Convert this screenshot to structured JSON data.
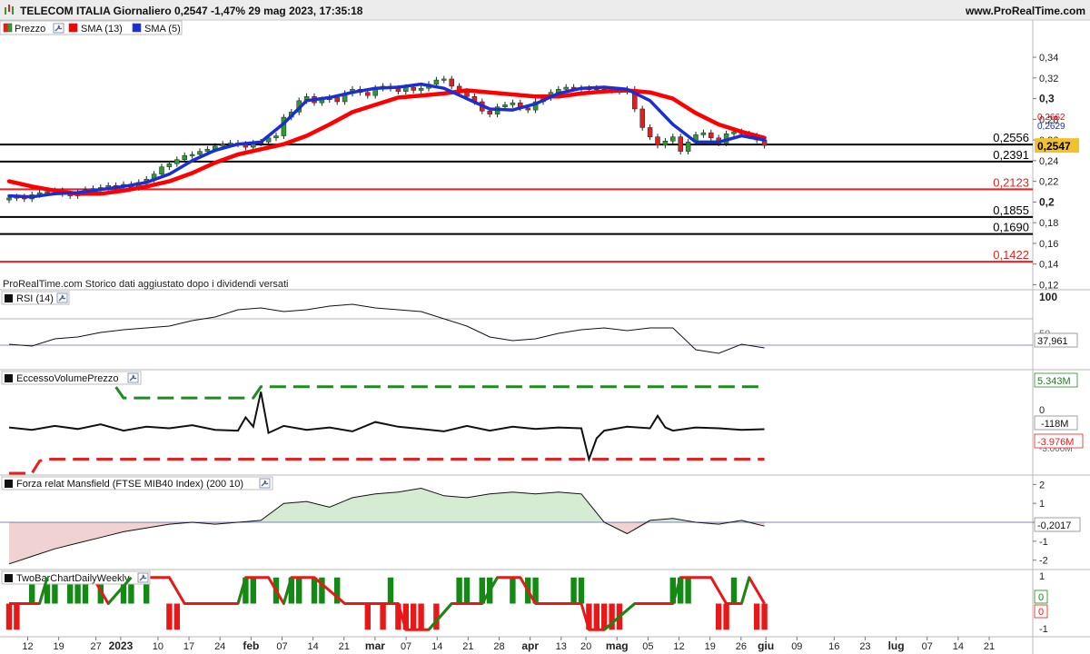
{
  "header": {
    "title": "TELECOM ITALIA Giornaliero 0,2547 -1,47% 29 mag 2023, 17:35:18",
    "site": "www.ProRealTime.com"
  },
  "colors": {
    "up_candle": "#2e9b2e",
    "down_candle": "#e02020",
    "sma13": "#ff0000",
    "sma5": "#1a2ed6",
    "last_price_box": "#f2c12e",
    "support_red": "#e82020",
    "volume_green": "#1f8a1f",
    "volume_red": "#e82020",
    "mansfield_pos_fill": "#d6ecd2",
    "mansfield_neg_fill": "#f0d2d2",
    "twobar_green": "#138a13",
    "twobar_red": "#e81818"
  },
  "price_panel": {
    "legend": [
      "Prezzo",
      "SMA (13)",
      "SMA (5)"
    ],
    "footnote": "ProRealTime.com Storico dati aggiustato dopo i dividendi versati",
    "axis_ticks": [
      "0,34",
      "0,32",
      "0,3",
      "0,28",
      "0,26",
      "0,24",
      "0,22",
      "0,2",
      "0,18",
      "0,16",
      "0,14",
      "0,12"
    ],
    "axis_tick_values": [
      0.34,
      0.32,
      0.3,
      0.28,
      0.26,
      0.24,
      0.22,
      0.2,
      0.18,
      0.16,
      0.14,
      0.12
    ],
    "ylim": [
      0.116,
      0.362
    ],
    "levels": [
      {
        "value": 0.2556,
        "label": "0,2556",
        "color": "black"
      },
      {
        "value": 0.2391,
        "label": "0,2391",
        "color": "black"
      },
      {
        "value": 0.2123,
        "label": "0,2123",
        "color": "red"
      },
      {
        "value": 0.1855,
        "label": "0,1855",
        "color": "black"
      },
      {
        "value": 0.169,
        "label": "0,1690",
        "color": "black"
      },
      {
        "value": 0.1422,
        "label": "0,1422",
        "color": "red"
      }
    ],
    "last_price_label": "0,2547",
    "last_price_value": 0.2547,
    "sma13_label": "0,2662",
    "sma13_value": 0.2662,
    "sma5_label": "0,2629",
    "sma5_value": 0.2629
  },
  "chart_data": [
    {
      "type": "candlestick",
      "name": "Prezzo",
      "x_range": [
        0,
        99
      ],
      "x": [
        0,
        1,
        2,
        3,
        4,
        5,
        6,
        7,
        8,
        9,
        10,
        11,
        12,
        13,
        14,
        15,
        16,
        17,
        18,
        19,
        20,
        21,
        22,
        23,
        24,
        25,
        26,
        27,
        28,
        29,
        30,
        31,
        32,
        33,
        34,
        35,
        36,
        37,
        38,
        39,
        40,
        41,
        42,
        43,
        44,
        45,
        46,
        47,
        48,
        49,
        50,
        51,
        52,
        53,
        54,
        55,
        56,
        57,
        58,
        59,
        60,
        61,
        62,
        63,
        64,
        65,
        66,
        67,
        68,
        69,
        70,
        71,
        72,
        73,
        74,
        75,
        76,
        77,
        78,
        79,
        80,
        81,
        82,
        83,
        84,
        85,
        86,
        87,
        88,
        89,
        90,
        91,
        92,
        93,
        94,
        95,
        96,
        97,
        98,
        99
      ],
      "close": [
        0.204,
        0.205,
        0.203,
        0.207,
        0.209,
        0.21,
        0.211,
        0.208,
        0.206,
        0.209,
        0.212,
        0.213,
        0.214,
        0.216,
        0.215,
        0.217,
        0.214,
        0.219,
        0.222,
        0.227,
        0.234,
        0.237,
        0.241,
        0.245,
        0.246,
        0.249,
        0.251,
        0.254,
        0.256,
        0.257,
        0.256,
        0.253,
        0.257,
        0.258,
        0.262,
        0.264,
        0.282,
        0.287,
        0.298,
        0.302,
        0.296,
        0.299,
        0.301,
        0.297,
        0.305,
        0.309,
        0.306,
        0.303,
        0.31,
        0.312,
        0.31,
        0.307,
        0.311,
        0.308,
        0.31,
        0.314,
        0.318,
        0.319,
        0.312,
        0.307,
        0.302,
        0.297,
        0.288,
        0.285,
        0.292,
        0.294,
        0.296,
        0.291,
        0.289,
        0.297,
        0.301,
        0.306,
        0.309,
        0.311,
        0.31,
        0.31,
        0.31,
        0.309,
        0.308,
        0.308,
        0.307,
        0.309,
        0.29,
        0.272,
        0.263,
        0.255,
        0.259,
        0.263,
        0.249,
        0.258,
        0.265,
        0.267,
        0.262,
        0.257,
        0.266,
        0.268,
        0.266,
        0.264,
        0.26,
        0.2547
      ],
      "ylim": [
        0.116,
        0.362
      ]
    },
    {
      "type": "line",
      "name": "SMA (13)",
      "x": [
        0,
        3,
        6,
        9,
        12,
        15,
        18,
        21,
        24,
        27,
        30,
        33,
        36,
        39,
        42,
        45,
        48,
        51,
        54,
        57,
        60,
        63,
        66,
        69,
        72,
        75,
        78,
        81,
        84,
        87,
        90,
        93,
        96,
        99
      ],
      "y": [
        0.22,
        0.215,
        0.211,
        0.208,
        0.208,
        0.211,
        0.215,
        0.22,
        0.228,
        0.238,
        0.246,
        0.251,
        0.256,
        0.264,
        0.275,
        0.287,
        0.294,
        0.301,
        0.303,
        0.305,
        0.308,
        0.306,
        0.304,
        0.302,
        0.302,
        0.305,
        0.307,
        0.308,
        0.306,
        0.3,
        0.286,
        0.275,
        0.268,
        0.262
      ],
      "ylim": [
        0.116,
        0.362
      ]
    },
    {
      "type": "line",
      "name": "SMA (5)",
      "x": [
        0,
        3,
        6,
        9,
        12,
        15,
        18,
        21,
        24,
        27,
        30,
        33,
        36,
        39,
        42,
        45,
        48,
        51,
        54,
        57,
        60,
        63,
        66,
        69,
        72,
        75,
        78,
        81,
        84,
        87,
        90,
        93,
        96,
        99
      ],
      "y": [
        0.206,
        0.205,
        0.208,
        0.209,
        0.212,
        0.215,
        0.219,
        0.227,
        0.24,
        0.25,
        0.256,
        0.258,
        0.276,
        0.298,
        0.301,
        0.306,
        0.31,
        0.311,
        0.314,
        0.31,
        0.3,
        0.29,
        0.289,
        0.295,
        0.305,
        0.31,
        0.311,
        0.309,
        0.298,
        0.275,
        0.258,
        0.258,
        0.264,
        0.26
      ],
      "ylim": [
        0.116,
        0.362
      ]
    },
    {
      "type": "line",
      "name": "RSI (14)",
      "axis_ticks": [
        "100",
        "50"
      ],
      "ylim": [
        15,
        100
      ],
      "last_label": "37,961",
      "last_value": 37.961,
      "x": [
        0,
        3,
        6,
        9,
        12,
        15,
        18,
        21,
        24,
        27,
        30,
        33,
        36,
        39,
        42,
        45,
        48,
        51,
        54,
        57,
        60,
        63,
        66,
        69,
        72,
        75,
        78,
        81,
        84,
        87,
        90,
        93,
        96,
        99
      ],
      "y": [
        42,
        40,
        48,
        50,
        55,
        58,
        60,
        62,
        68,
        72,
        80,
        82,
        78,
        80,
        84,
        86,
        82,
        80,
        78,
        70,
        62,
        50,
        46,
        48,
        54,
        58,
        60,
        57,
        60,
        60,
        36,
        32,
        42,
        38
      ]
    },
    {
      "type": "line",
      "name": "EccessoVolumePrezzo",
      "axis_ticks": [
        "0",
        "-3.000M"
      ],
      "ylim": [
        -5.9,
        7.3
      ],
      "upper_label": "5.343M",
      "upper_value": 5.343,
      "mid_label": "-118M",
      "mid_value": -0.118,
      "lower_label": "-3.976M",
      "lower_value": -3.976,
      "upper_band_x": [
        14,
        15,
        16,
        32,
        33,
        34,
        99
      ],
      "upper_band_y": [
        5.3,
        3.9,
        3.9,
        3.9,
        5.343,
        5.343,
        5.343
      ],
      "lower_band_x": [
        0,
        2,
        3,
        4,
        5,
        99
      ],
      "lower_band_y": [
        -8.0,
        -8.0,
        -8.0,
        -4.2,
        -3.976,
        -3.976
      ],
      "x": [
        0,
        3,
        6,
        9,
        12,
        15,
        18,
        21,
        24,
        27,
        30,
        31,
        32,
        33,
        34,
        36,
        39,
        42,
        45,
        48,
        51,
        54,
        57,
        60,
        63,
        66,
        69,
        72,
        75,
        76,
        77,
        78,
        81,
        84,
        85,
        86,
        87,
        90,
        93,
        96,
        99
      ],
      "y": [
        0.1,
        -0.2,
        0.3,
        -0.1,
        0.5,
        -0.3,
        0.2,
        0.0,
        0.4,
        -0.2,
        -0.3,
        1.4,
        0.2,
        4.7,
        -0.6,
        0.3,
        -0.2,
        0.1,
        -0.4,
        0.8,
        0.2,
        -0.1,
        -0.4,
        0.3,
        -0.3,
        0.2,
        -0.1,
        0.1,
        0.0,
        -4.0,
        -1.3,
        -0.3,
        0.2,
        0.0,
        1.6,
        0.1,
        -0.3,
        0.1,
        0.0,
        -0.2,
        -0.118
      ]
    },
    {
      "type": "area",
      "name": "Forza relat Mansfield (FTSE MIB40 Index) (200 10)",
      "axis_ticks": [
        "2",
        "1",
        "0",
        "-1",
        "-2"
      ],
      "axis_tick_values": [
        2,
        1,
        0,
        -1,
        -2
      ],
      "ylim": [
        -2.4,
        2.4
      ],
      "last_label": "-0,2017",
      "last_value": -0.2017,
      "x": [
        0,
        3,
        6,
        9,
        12,
        15,
        18,
        21,
        24,
        27,
        30,
        33,
        36,
        39,
        42,
        45,
        48,
        51,
        54,
        57,
        60,
        63,
        66,
        69,
        72,
        75,
        78,
        81,
        84,
        87,
        90,
        93,
        96,
        99
      ],
      "y": [
        -2.2,
        -1.8,
        -1.4,
        -1.1,
        -0.8,
        -0.5,
        -0.3,
        -0.1,
        0.0,
        -0.1,
        0.0,
        0.1,
        1.0,
        1.1,
        0.8,
        1.3,
        1.5,
        1.6,
        1.8,
        1.4,
        1.3,
        1.5,
        1.6,
        1.5,
        1.6,
        1.5,
        0.0,
        -0.6,
        0.1,
        0.2,
        0.0,
        -0.1,
        0.1,
        -0.2
      ]
    },
    {
      "type": "step",
      "name": "TwoBarChartDailyWeekly",
      "axis_ticks": [
        "1",
        "0",
        "0",
        "-1"
      ],
      "ylim": [
        -1.2,
        1.2
      ],
      "line_x": [
        0,
        4,
        5,
        11,
        13,
        16,
        21,
        23,
        30,
        31,
        34,
        36,
        37,
        40,
        44,
        51,
        52,
        55,
        58,
        62,
        64,
        67,
        69,
        72,
        75,
        76,
        78,
        82,
        85,
        87,
        88,
        92,
        94,
        96,
        97,
        99
      ],
      "line_y": [
        0,
        0,
        1,
        1,
        0,
        1,
        1,
        0,
        0,
        1,
        1,
        0,
        1,
        1,
        0,
        0,
        -1,
        -1,
        0,
        0,
        1,
        1,
        0,
        0,
        0,
        -1,
        -1,
        0,
        0,
        0,
        1,
        1,
        0,
        0,
        1,
        0
      ],
      "bars_x": [
        0,
        1,
        2,
        3,
        4,
        5,
        6,
        7,
        8,
        9,
        10,
        11,
        12,
        13,
        14,
        15,
        16,
        17,
        18,
        19,
        20,
        21,
        22,
        23,
        24,
        25,
        26,
        27,
        28,
        29,
        30,
        31,
        32,
        33,
        34,
        35,
        36,
        37,
        38,
        39,
        40,
        41,
        42,
        43,
        44,
        45,
        46,
        47,
        48,
        49,
        50,
        51,
        52,
        53,
        54,
        55,
        56,
        57,
        58,
        59,
        60,
        61,
        62,
        63,
        64,
        65,
        66,
        67,
        68,
        69,
        70,
        71,
        72,
        73,
        74,
        75,
        76,
        77,
        78,
        79,
        80,
        81,
        82,
        83,
        84,
        85,
        86,
        87,
        88,
        89,
        90,
        91,
        92,
        93,
        94,
        95,
        96,
        97,
        98,
        99
      ],
      "bars": [
        -1,
        -1,
        0,
        1,
        0,
        1,
        1,
        0,
        1,
        1,
        1,
        0,
        1,
        0,
        0,
        1,
        1,
        0,
        1,
        0,
        0,
        -1,
        -1,
        0,
        0,
        0,
        0,
        0,
        0,
        0,
        0,
        1,
        1,
        0,
        0,
        1,
        0,
        1,
        1,
        0,
        1,
        1,
        0,
        1,
        0,
        0,
        0,
        -1,
        0,
        -1,
        1,
        -1,
        -1,
        -1,
        -1,
        0,
        -1,
        0,
        0,
        1,
        1,
        0,
        1,
        1,
        0,
        0,
        1,
        0,
        1,
        1,
        0,
        0,
        0,
        0,
        1,
        1,
        -1,
        -1,
        -1,
        -1,
        -1,
        0,
        0,
        0,
        0,
        0,
        0,
        1,
        1,
        1,
        0,
        0,
        0,
        -1,
        -1,
        1,
        0,
        0,
        -1,
        -1
      ]
    }
  ],
  "x_axis": {
    "labels": [
      "12",
      "19",
      "27",
      "2023",
      "10",
      "17",
      "24",
      "feb",
      "07",
      "14",
      "21",
      "mar",
      "07",
      "14",
      "21",
      "28",
      "apr",
      "13",
      "20",
      "mag",
      "05",
      "12",
      "19",
      "26",
      "giu",
      "09",
      "16",
      "23",
      "lug",
      "07",
      "14",
      "21"
    ],
    "bold": [
      false,
      false,
      false,
      true,
      false,
      false,
      false,
      true,
      false,
      false,
      false,
      true,
      false,
      false,
      false,
      false,
      true,
      false,
      false,
      true,
      false,
      false,
      false,
      false,
      true,
      false,
      false,
      false,
      true,
      false,
      false,
      false
    ],
    "bar_index": [
      3,
      8,
      14,
      18,
      24,
      29,
      34,
      39,
      44,
      49,
      54,
      59,
      64,
      69,
      74,
      79,
      84,
      89,
      93,
      98,
      103,
      108,
      113,
      118,
      122,
      127,
      133,
      138,
      143,
      148,
      153,
      158
    ]
  },
  "legends": {
    "rsi": "RSI (14)",
    "volume": "EccessoVolumePrezzo",
    "mansfield": "Forza relat Mansfield (FTSE MIB40 Index) (200 10)",
    "twobar": "TwoBarChartDailyWeekly"
  }
}
